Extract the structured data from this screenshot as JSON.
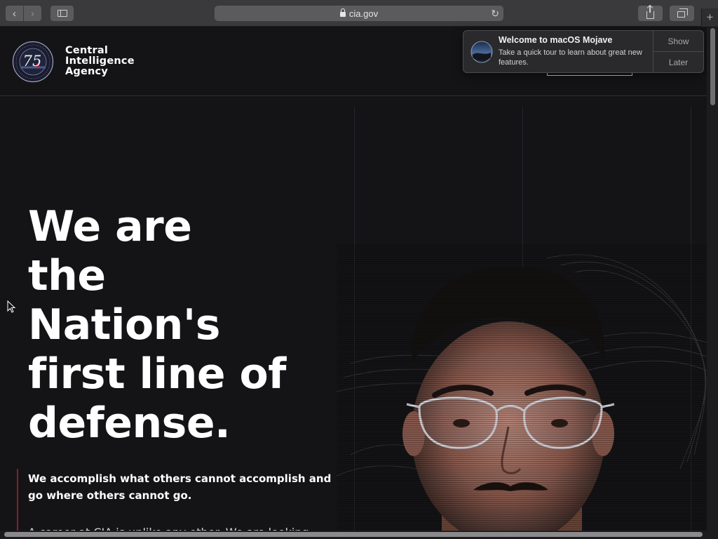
{
  "browser": {
    "url": "cia.gov",
    "back_glyph": "‹",
    "forward_glyph": "›",
    "reload_glyph": "↻",
    "new_tab_glyph": "+",
    "icons": [
      "chevron-left-icon",
      "chevron-right-icon",
      "sidebar-icon",
      "lock-icon",
      "reload-icon",
      "share-icon",
      "tabs-icon",
      "plus-icon"
    ]
  },
  "site": {
    "brand_lines": [
      "Central",
      "Intelligence",
      "Agency"
    ],
    "seal_text": "75",
    "seal_icon": "cia-75th-anniversary-seal"
  },
  "hero": {
    "headline_lines": [
      "We are",
      "the",
      "Nation's",
      "first line of",
      "defense."
    ],
    "tagline": "We accomplish what others cannot accomplish and go where others cannot go.",
    "body": "A career at CIA is unlike any other. We are looking",
    "accent_color": "#8c1c2a"
  },
  "notification": {
    "title": "Welcome to macOS Mojave",
    "body": "Take a quick tour to learn about great new features.",
    "show_label": "Show",
    "later_label": "Later",
    "icon": "macos-mojave-icon"
  },
  "colors": {
    "background": "#141416",
    "toolbar": "#3a3a3c",
    "text": "#ffffff"
  }
}
